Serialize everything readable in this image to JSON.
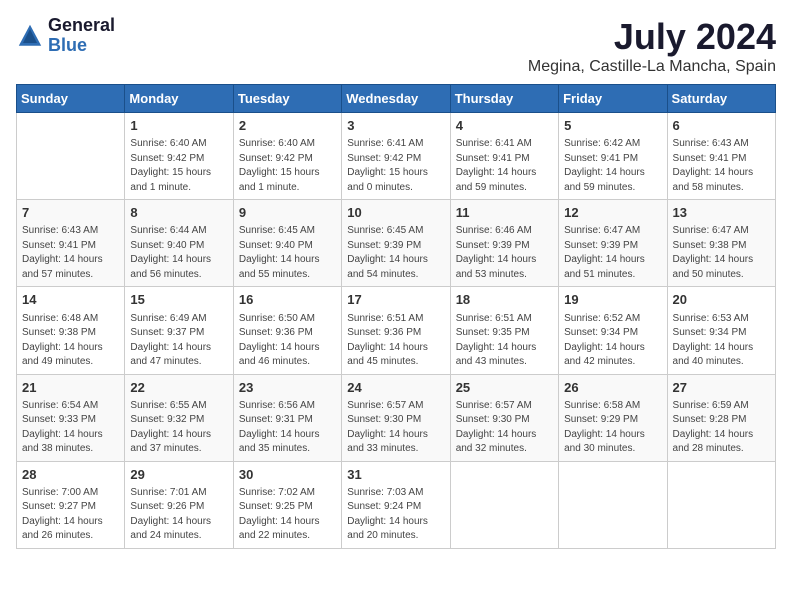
{
  "header": {
    "logo_general": "General",
    "logo_blue": "Blue",
    "month_year": "July 2024",
    "location": "Megina, Castille-La Mancha, Spain"
  },
  "days_of_week": [
    "Sunday",
    "Monday",
    "Tuesday",
    "Wednesday",
    "Thursday",
    "Friday",
    "Saturday"
  ],
  "weeks": [
    [
      {
        "day": "",
        "info": ""
      },
      {
        "day": "1",
        "info": "Sunrise: 6:40 AM\nSunset: 9:42 PM\nDaylight: 15 hours\nand 1 minute."
      },
      {
        "day": "2",
        "info": "Sunrise: 6:40 AM\nSunset: 9:42 PM\nDaylight: 15 hours\nand 1 minute."
      },
      {
        "day": "3",
        "info": "Sunrise: 6:41 AM\nSunset: 9:42 PM\nDaylight: 15 hours\nand 0 minutes."
      },
      {
        "day": "4",
        "info": "Sunrise: 6:41 AM\nSunset: 9:41 PM\nDaylight: 14 hours\nand 59 minutes."
      },
      {
        "day": "5",
        "info": "Sunrise: 6:42 AM\nSunset: 9:41 PM\nDaylight: 14 hours\nand 59 minutes."
      },
      {
        "day": "6",
        "info": "Sunrise: 6:43 AM\nSunset: 9:41 PM\nDaylight: 14 hours\nand 58 minutes."
      }
    ],
    [
      {
        "day": "7",
        "info": "Sunrise: 6:43 AM\nSunset: 9:41 PM\nDaylight: 14 hours\nand 57 minutes."
      },
      {
        "day": "8",
        "info": "Sunrise: 6:44 AM\nSunset: 9:40 PM\nDaylight: 14 hours\nand 56 minutes."
      },
      {
        "day": "9",
        "info": "Sunrise: 6:45 AM\nSunset: 9:40 PM\nDaylight: 14 hours\nand 55 minutes."
      },
      {
        "day": "10",
        "info": "Sunrise: 6:45 AM\nSunset: 9:39 PM\nDaylight: 14 hours\nand 54 minutes."
      },
      {
        "day": "11",
        "info": "Sunrise: 6:46 AM\nSunset: 9:39 PM\nDaylight: 14 hours\nand 53 minutes."
      },
      {
        "day": "12",
        "info": "Sunrise: 6:47 AM\nSunset: 9:39 PM\nDaylight: 14 hours\nand 51 minutes."
      },
      {
        "day": "13",
        "info": "Sunrise: 6:47 AM\nSunset: 9:38 PM\nDaylight: 14 hours\nand 50 minutes."
      }
    ],
    [
      {
        "day": "14",
        "info": "Sunrise: 6:48 AM\nSunset: 9:38 PM\nDaylight: 14 hours\nand 49 minutes."
      },
      {
        "day": "15",
        "info": "Sunrise: 6:49 AM\nSunset: 9:37 PM\nDaylight: 14 hours\nand 47 minutes."
      },
      {
        "day": "16",
        "info": "Sunrise: 6:50 AM\nSunset: 9:36 PM\nDaylight: 14 hours\nand 46 minutes."
      },
      {
        "day": "17",
        "info": "Sunrise: 6:51 AM\nSunset: 9:36 PM\nDaylight: 14 hours\nand 45 minutes."
      },
      {
        "day": "18",
        "info": "Sunrise: 6:51 AM\nSunset: 9:35 PM\nDaylight: 14 hours\nand 43 minutes."
      },
      {
        "day": "19",
        "info": "Sunrise: 6:52 AM\nSunset: 9:34 PM\nDaylight: 14 hours\nand 42 minutes."
      },
      {
        "day": "20",
        "info": "Sunrise: 6:53 AM\nSunset: 9:34 PM\nDaylight: 14 hours\nand 40 minutes."
      }
    ],
    [
      {
        "day": "21",
        "info": "Sunrise: 6:54 AM\nSunset: 9:33 PM\nDaylight: 14 hours\nand 38 minutes."
      },
      {
        "day": "22",
        "info": "Sunrise: 6:55 AM\nSunset: 9:32 PM\nDaylight: 14 hours\nand 37 minutes."
      },
      {
        "day": "23",
        "info": "Sunrise: 6:56 AM\nSunset: 9:31 PM\nDaylight: 14 hours\nand 35 minutes."
      },
      {
        "day": "24",
        "info": "Sunrise: 6:57 AM\nSunset: 9:30 PM\nDaylight: 14 hours\nand 33 minutes."
      },
      {
        "day": "25",
        "info": "Sunrise: 6:57 AM\nSunset: 9:30 PM\nDaylight: 14 hours\nand 32 minutes."
      },
      {
        "day": "26",
        "info": "Sunrise: 6:58 AM\nSunset: 9:29 PM\nDaylight: 14 hours\nand 30 minutes."
      },
      {
        "day": "27",
        "info": "Sunrise: 6:59 AM\nSunset: 9:28 PM\nDaylight: 14 hours\nand 28 minutes."
      }
    ],
    [
      {
        "day": "28",
        "info": "Sunrise: 7:00 AM\nSunset: 9:27 PM\nDaylight: 14 hours\nand 26 minutes."
      },
      {
        "day": "29",
        "info": "Sunrise: 7:01 AM\nSunset: 9:26 PM\nDaylight: 14 hours\nand 24 minutes."
      },
      {
        "day": "30",
        "info": "Sunrise: 7:02 AM\nSunset: 9:25 PM\nDaylight: 14 hours\nand 22 minutes."
      },
      {
        "day": "31",
        "info": "Sunrise: 7:03 AM\nSunset: 9:24 PM\nDaylight: 14 hours\nand 20 minutes."
      },
      {
        "day": "",
        "info": ""
      },
      {
        "day": "",
        "info": ""
      },
      {
        "day": "",
        "info": ""
      }
    ]
  ]
}
